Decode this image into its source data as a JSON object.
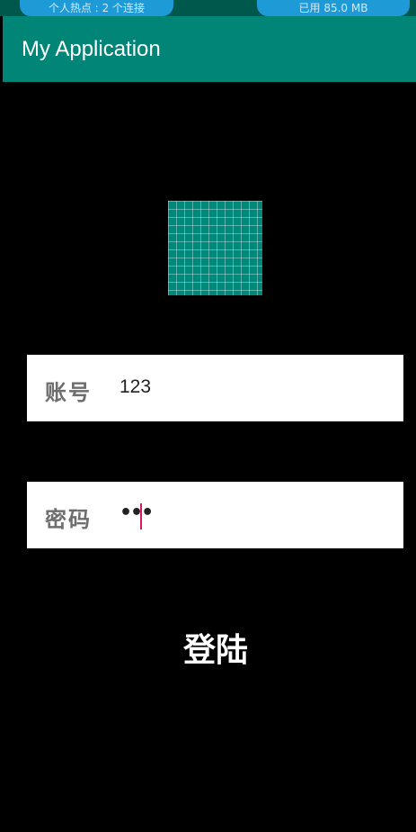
{
  "status_bar": {
    "hotspot_text": "个人热点 : 2 个连接",
    "memory_text": "已用 85.0 MB"
  },
  "app_bar": {
    "title": "My Application"
  },
  "form": {
    "account_label": "账号",
    "account_value": "123",
    "password_label": "密码",
    "password_mask": "•••"
  },
  "login_button": {
    "label": "登陆"
  },
  "colors": {
    "app_bar": "#008577",
    "status_bar": "#00574b",
    "accent_cursor": "#d81b60",
    "pill": "#1e9bd7"
  }
}
